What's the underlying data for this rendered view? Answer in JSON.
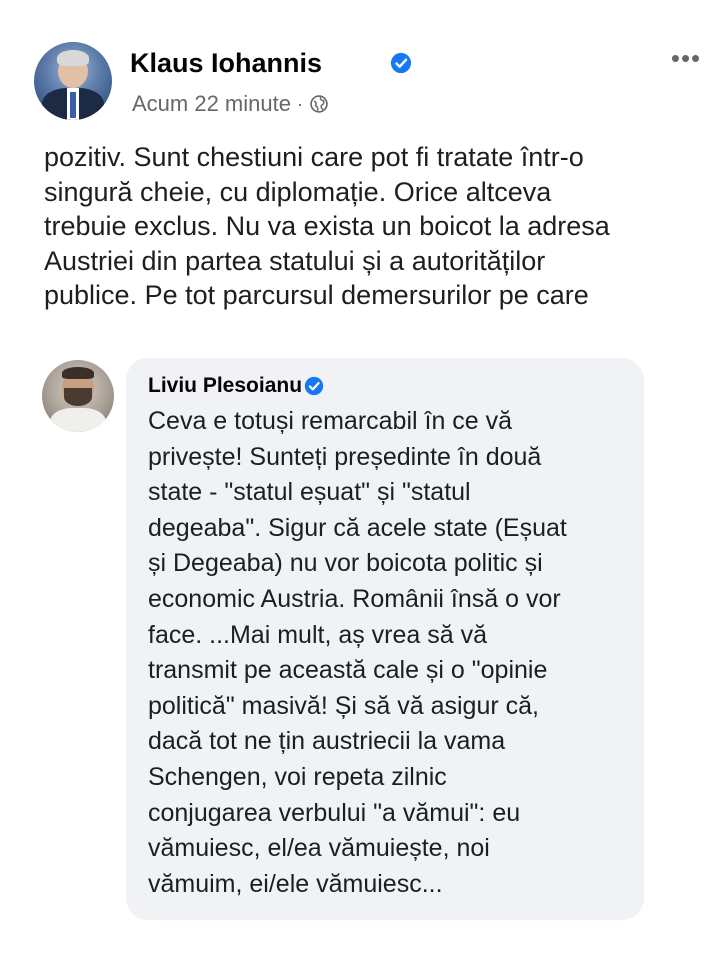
{
  "post": {
    "author": "Klaus Iohannis",
    "time": "Acum 22 minute",
    "separator": "·",
    "more_label": "•••",
    "body_lines": [
      "pozitiv. Sunt chestiuni care pot fi tratate într-o",
      "singură cheie, cu diplomație. Orice altceva",
      "trebuie exclus. Nu va exista un boicot la adresa",
      "Austriei din partea statului și a autorităților",
      "publice. Pe tot parcursul demersurilor pe care"
    ]
  },
  "reply": {
    "author": "Liviu Plesoianu",
    "body_lines": [
      "Ceva e totuși remarcabil în ce vă",
      "privește! Sunteți președinte în două",
      "state - \"statul eșuat\" și \"statul",
      "degeaba\". Sigur că acele state (Eșuat",
      "și Degeaba) nu vor boicota politic și",
      "economic Austria. Românii însă o vor",
      "face. ...Mai mult, aș vrea să vă",
      "transmit pe această cale și o \"opinie",
      "politică\" masivă! Și să vă asigur că,",
      "dacă tot ne țin austriecii la vama",
      "Schengen, voi repeta zilnic",
      "conjugarea verbului \"a vămui\": eu",
      "vămuiesc, el/ea vămuiește, noi",
      "vămuim, ei/ele vămuiesc..."
    ]
  },
  "icons": {
    "verified": "verified-badge-icon",
    "privacy": "globe-icon",
    "more": "more-options-icon"
  },
  "colors": {
    "verified": "#1877f2",
    "secondary_text": "#65676b",
    "bubble": "#f0f2f5"
  }
}
